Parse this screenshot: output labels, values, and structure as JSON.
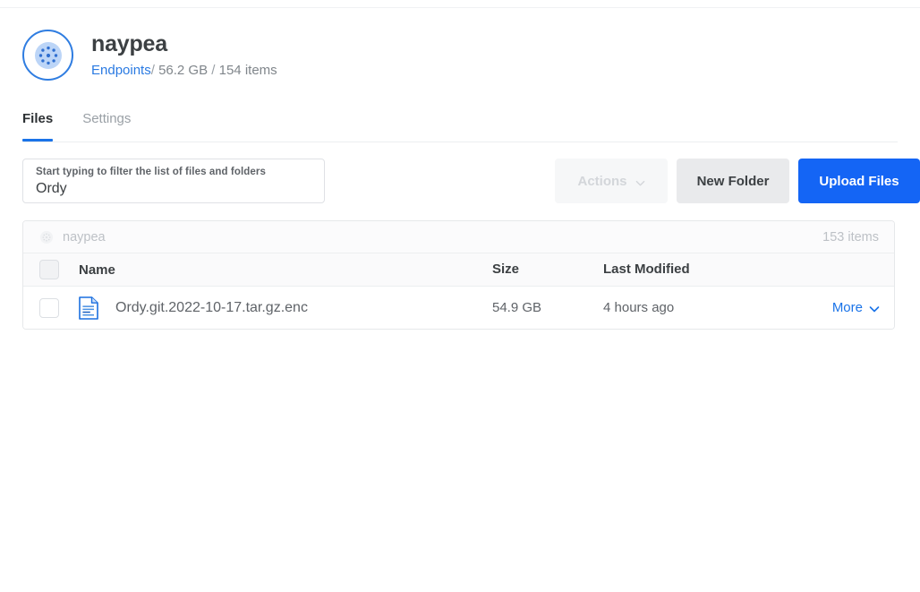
{
  "header": {
    "logo_icon": "dotted-circle-logo",
    "org_title": "naypea",
    "breadcrumb": {
      "link_label": "Endpoints",
      "sep1": "/",
      "size": "56.2 GB",
      "sep2": "/",
      "items": "154 items"
    }
  },
  "tabs": [
    {
      "label": "Files",
      "active": true
    },
    {
      "label": "Settings",
      "active": false
    }
  ],
  "toolbar": {
    "filter": {
      "label": "Start typing to filter the list of files and folders",
      "value": "Ordy",
      "placeholder": ""
    },
    "actions_label": "Actions",
    "actions_chevron_icon": "chevron-down-icon",
    "new_folder_label": "New Folder",
    "upload_files_label": "Upload Files"
  },
  "file_browser": {
    "breadcrumb_icon": "dotted-circle-logo-muted",
    "breadcrumb_label": "naypea",
    "item_count": "153 items",
    "columns": {
      "name": "Name",
      "size": "Size",
      "last_modified": "Last Modified"
    },
    "rows": [
      {
        "icon": "file-document-icon",
        "name": "Ordy.git.2022-10-17.tar.gz.enc",
        "size": "54.9 GB",
        "last_modified": "4 hours ago",
        "more_label": "More",
        "more_chevron_icon": "chevron-down-icon"
      }
    ]
  },
  "colors": {
    "accent_blue": "#1465f5",
    "link_blue": "#1a73e8",
    "logo_blue": "#2f7de1",
    "text_dark": "#3c4043",
    "text_muted": "#80868b",
    "text_disabled": "#d3d6da"
  }
}
